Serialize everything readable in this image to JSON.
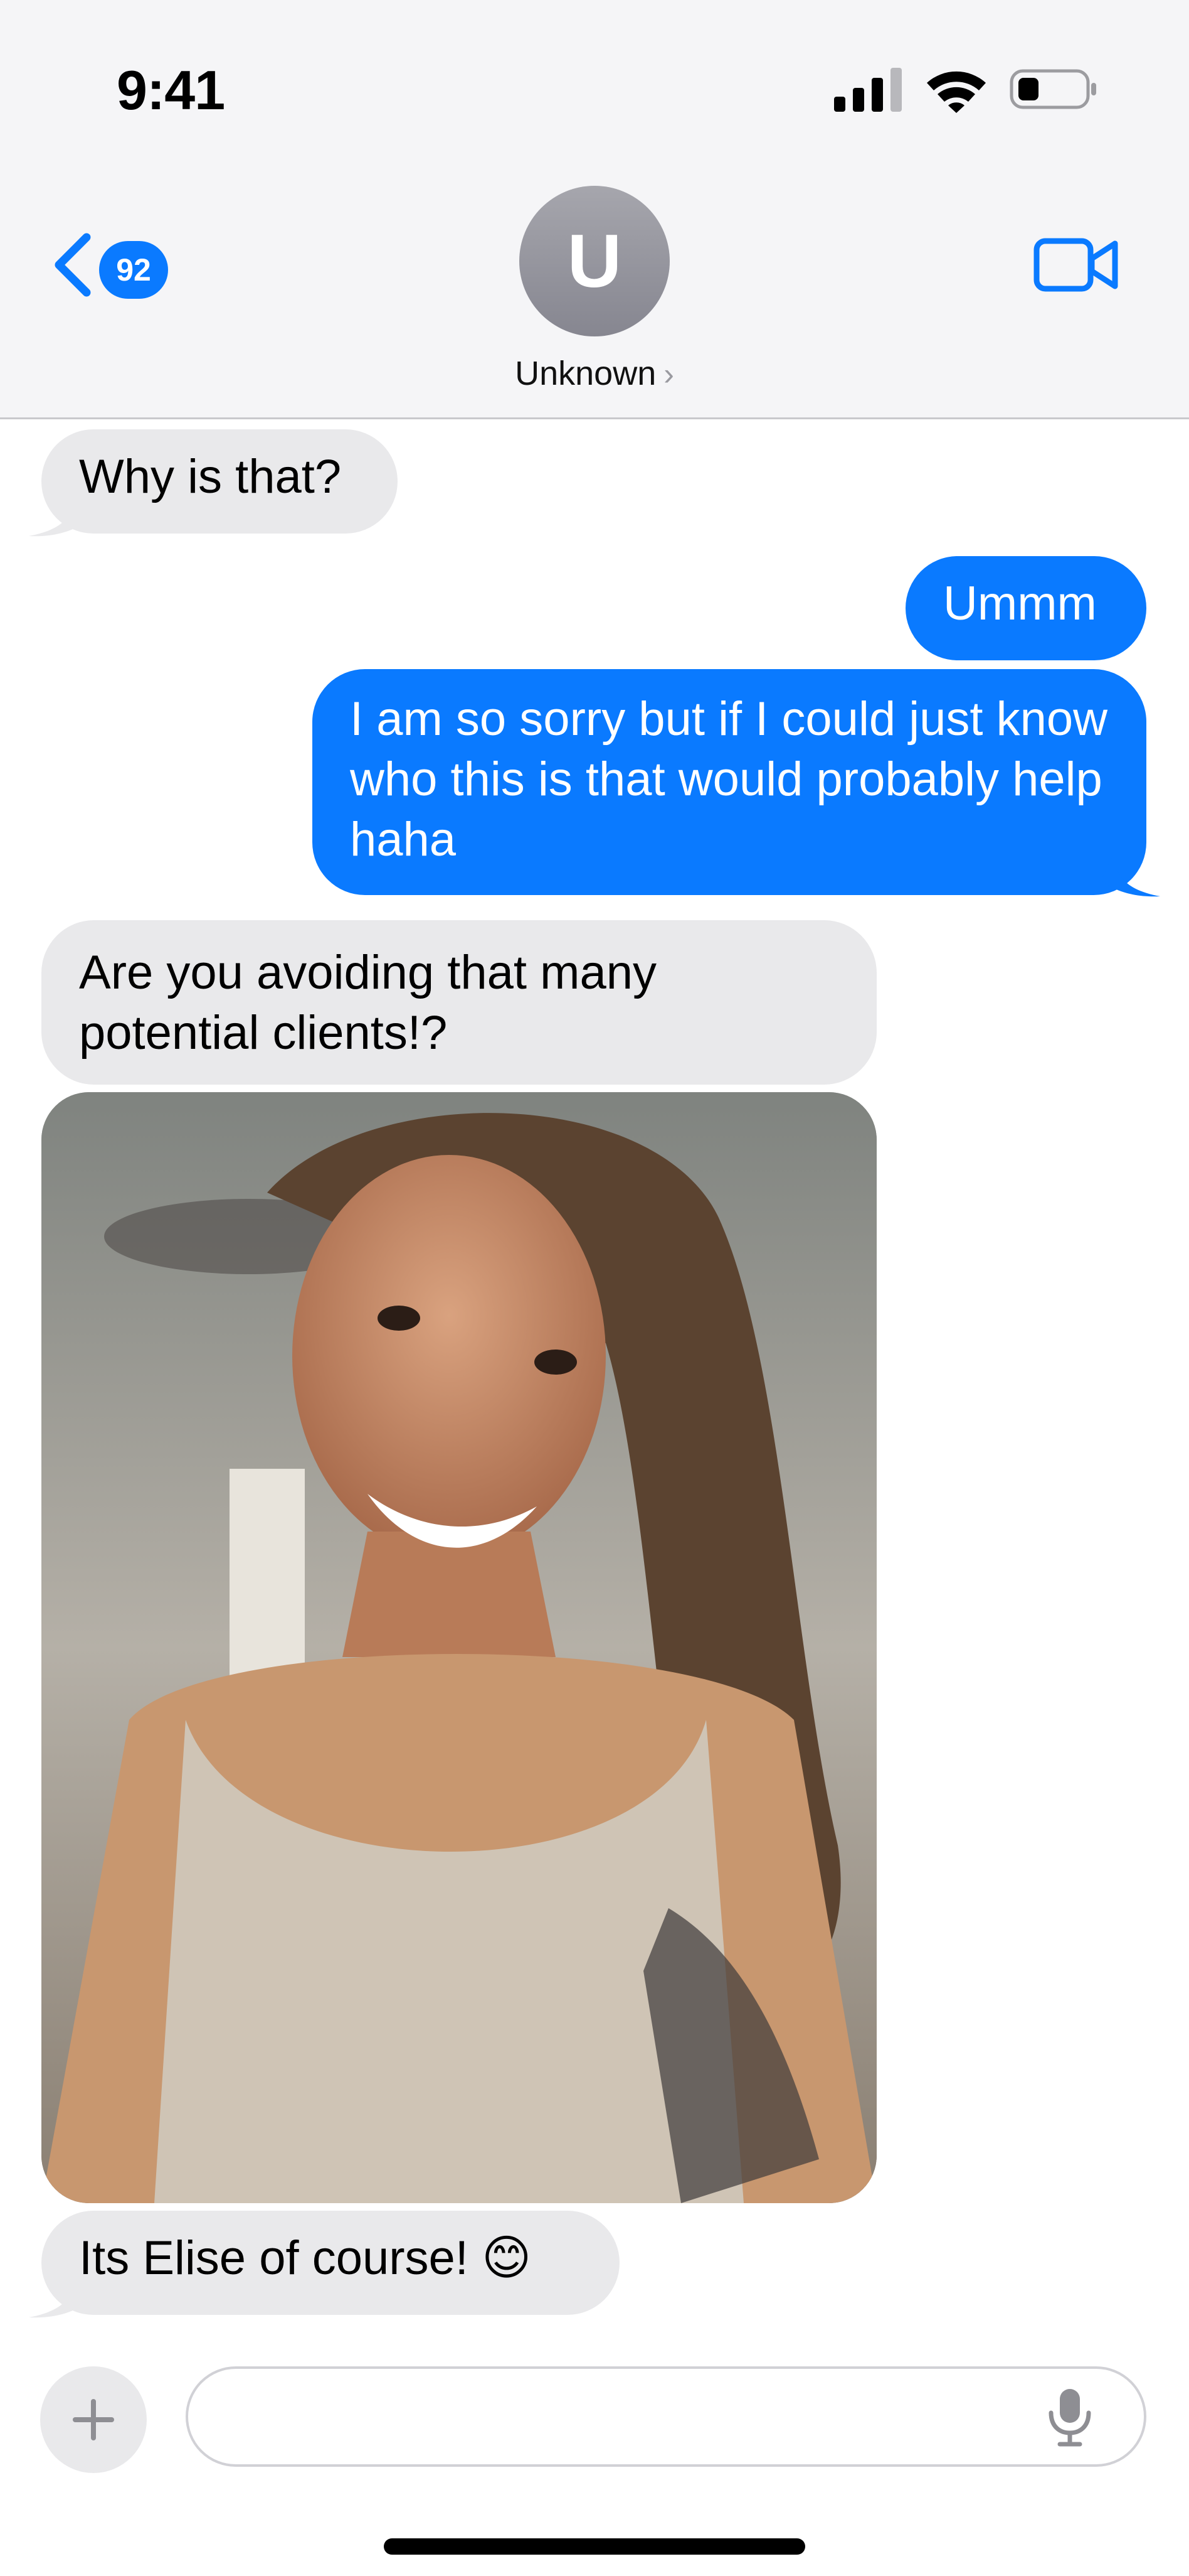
{
  "status_bar": {
    "time": "9:41",
    "icons": [
      "signal-icon",
      "wifi-icon",
      "battery-icon"
    ]
  },
  "nav": {
    "back_badge": "92",
    "avatar_initial": "U",
    "contact_name": "Unknown",
    "icons": [
      "chevron-left-icon",
      "video-camera-icon",
      "chevron-right-icon"
    ]
  },
  "messages": [
    {
      "direction": "incoming",
      "text": "Why is that?"
    },
    {
      "direction": "outgoing",
      "text": "Ummm"
    },
    {
      "direction": "outgoing",
      "text": "I am so sorry but if I could just know who this is that would probably help haha"
    },
    {
      "direction": "incoming",
      "text": "Are you avoiding that many potential clients!?"
    },
    {
      "direction": "incoming",
      "type": "photo"
    },
    {
      "direction": "incoming",
      "text": "Its Elise of course! 😊"
    }
  ],
  "composer": {
    "placeholder": "",
    "icons": [
      "plus-icon",
      "microphone-icon"
    ]
  },
  "colors": {
    "outgoing_bubble": "#0a7aff",
    "incoming_bubble": "#e9e9eb",
    "header_background": "#f5f5f7"
  }
}
